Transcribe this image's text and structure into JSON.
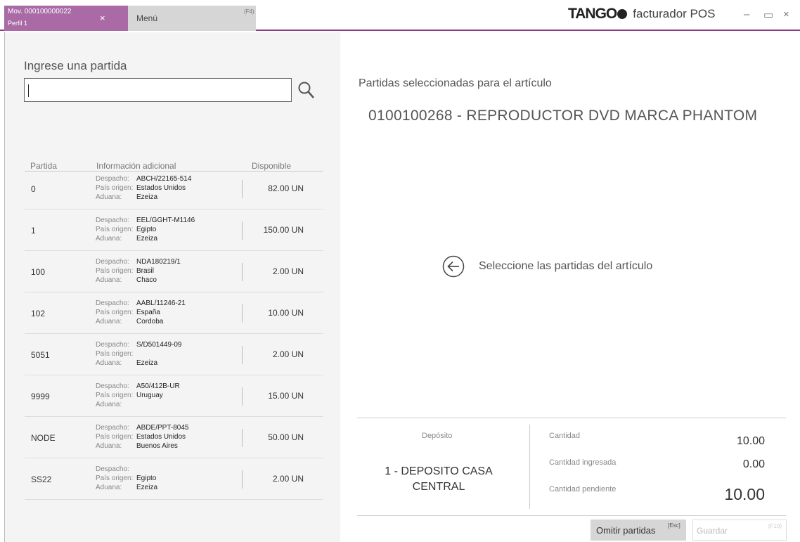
{
  "tabs": {
    "active": {
      "title": "Mov. 000100000022",
      "subtitle": "Perfil 1",
      "close": "×"
    },
    "menu": {
      "label": "Menú",
      "shortcut": "(F4)"
    }
  },
  "brand": {
    "logo": "TANGO",
    "app": "facturador POS"
  },
  "window_controls": {
    "minimize": "–",
    "maximize": "▭",
    "close": "×"
  },
  "search": {
    "heading": "Ingrese una partida",
    "value": "",
    "icon": "search-icon"
  },
  "columns": {
    "partida": "Partida",
    "info": "Información adicional",
    "disponible": "Disponible"
  },
  "info_labels": {
    "despacho": "Despacho:",
    "pais": "País origen:",
    "aduana": "Aduana:"
  },
  "rows": [
    {
      "partida": "0",
      "despacho": "ABCH/22165-514",
      "pais": "Estados Unidos",
      "aduana": "Ezeiza",
      "disponible": "82.00 UN"
    },
    {
      "partida": "1",
      "despacho": "EEL/GGHT-M1146",
      "pais": "Egipto",
      "aduana": "Ezeiza",
      "disponible": "150.00 UN"
    },
    {
      "partida": "100",
      "despacho": "NDA180219/1",
      "pais": "Brasil",
      "aduana": "Chaco",
      "disponible": "2.00 UN"
    },
    {
      "partida": "102",
      "despacho": "AABL/11246-21",
      "pais": "España",
      "aduana": "Cordoba",
      "disponible": "10.00 UN"
    },
    {
      "partida": "5051",
      "despacho": "S/D501449-09",
      "pais": "",
      "aduana": "Ezeiza",
      "disponible": "2.00 UN"
    },
    {
      "partida": "9999",
      "despacho": "A50/412B-UR",
      "pais": "Uruguay",
      "aduana": "",
      "disponible": "15.00 UN"
    },
    {
      "partida": "NODE",
      "despacho": "ABDE/PPT-8045",
      "pais": "Estados Unidos",
      "aduana": "Buenos Aires",
      "disponible": "50.00 UN"
    },
    {
      "partida": "SS22",
      "despacho": "",
      "pais": "Egipto",
      "aduana": "Ezeiza",
      "disponible": "2.00 UN"
    }
  ],
  "right": {
    "title": "Partidas seleccionadas para el artículo",
    "article": "0100100268  -  REPRODUCTOR DVD MARCA PHANTOM",
    "hint": "Seleccione las partidas del artículo"
  },
  "deposito": {
    "label": "Depósito",
    "line1": "1 - DEPOSITO CASA",
    "line2": "CENTRAL"
  },
  "cantidades": {
    "cantidad_label": "Cantidad",
    "cantidad": "10.00",
    "ingresada_label": "Cantidad ingresada",
    "ingresada": "0.00",
    "pendiente_label": "Cantidad pendiente",
    "pendiente": "10.00"
  },
  "buttons": {
    "omit": "Omitir partidas",
    "omit_key": "[Esc]",
    "save": "Guardar",
    "save_key": "(F10)"
  },
  "colors": {
    "accent": "#8b3a88",
    "tab_active": "#a96aa6"
  }
}
